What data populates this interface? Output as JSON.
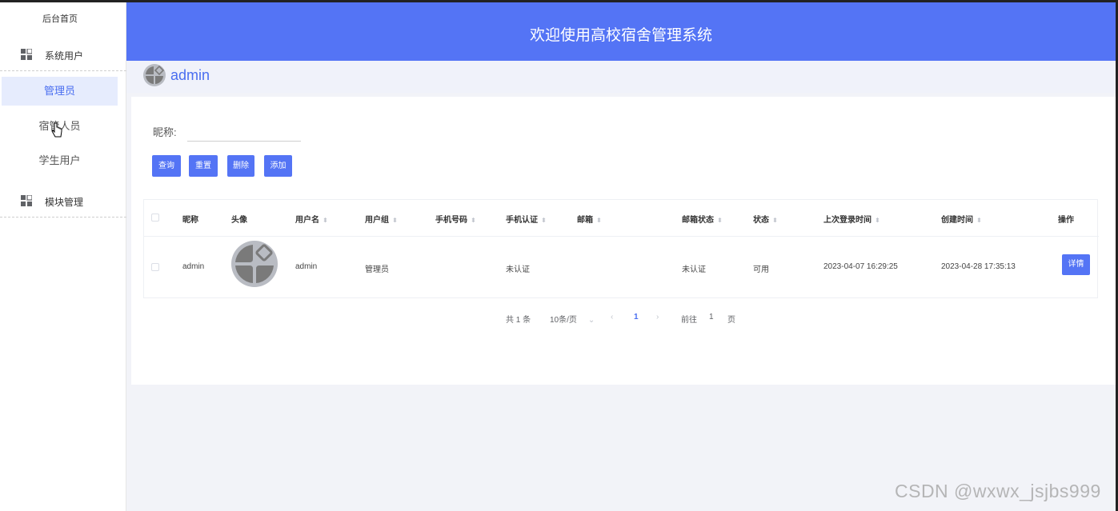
{
  "sidebar": {
    "home": "后台首页",
    "groups": [
      {
        "label": "系统用户",
        "icon": "grid-icon"
      },
      {
        "label": "模块管理",
        "icon": "grid-icon"
      }
    ],
    "sub_items": [
      "管理员",
      "宿管人员",
      "学生用户"
    ],
    "active_item": "管理员"
  },
  "header": {
    "title": "欢迎使用高校宿舍管理系统"
  },
  "userbar": {
    "username": "admin"
  },
  "search": {
    "label": "昵称:",
    "value": "",
    "placeholder": ""
  },
  "buttons": {
    "query": "查询",
    "reset": "重置",
    "delete": "删除",
    "add": "添加"
  },
  "table": {
    "columns": [
      "昵称",
      "头像",
      "用户名",
      "用户组",
      "手机号码",
      "手机认证",
      "邮箱",
      "邮箱状态",
      "状态",
      "上次登录时间",
      "创建时间",
      "操作"
    ],
    "rows": [
      {
        "nickname": "admin",
        "username": "admin",
        "group": "管理员",
        "phone": "",
        "phone_auth": "未认证",
        "email": "",
        "email_status": "未认证",
        "status": "可用",
        "last_login": "2023-04-07 16:29:25",
        "created": "2023-04-28 17:35:13",
        "action": "详情"
      }
    ]
  },
  "pagination": {
    "total": "共 1 条",
    "page_size": "10条/页",
    "current_page": "1",
    "goto_label": "前往",
    "goto_value": "1",
    "page_suffix": "页"
  },
  "watermark": "CSDN @wxwx_jsjbs999",
  "colors": {
    "primary": "#5474f5",
    "active_bg": "#e6ecfd",
    "active_text": "#4a6ef0"
  }
}
